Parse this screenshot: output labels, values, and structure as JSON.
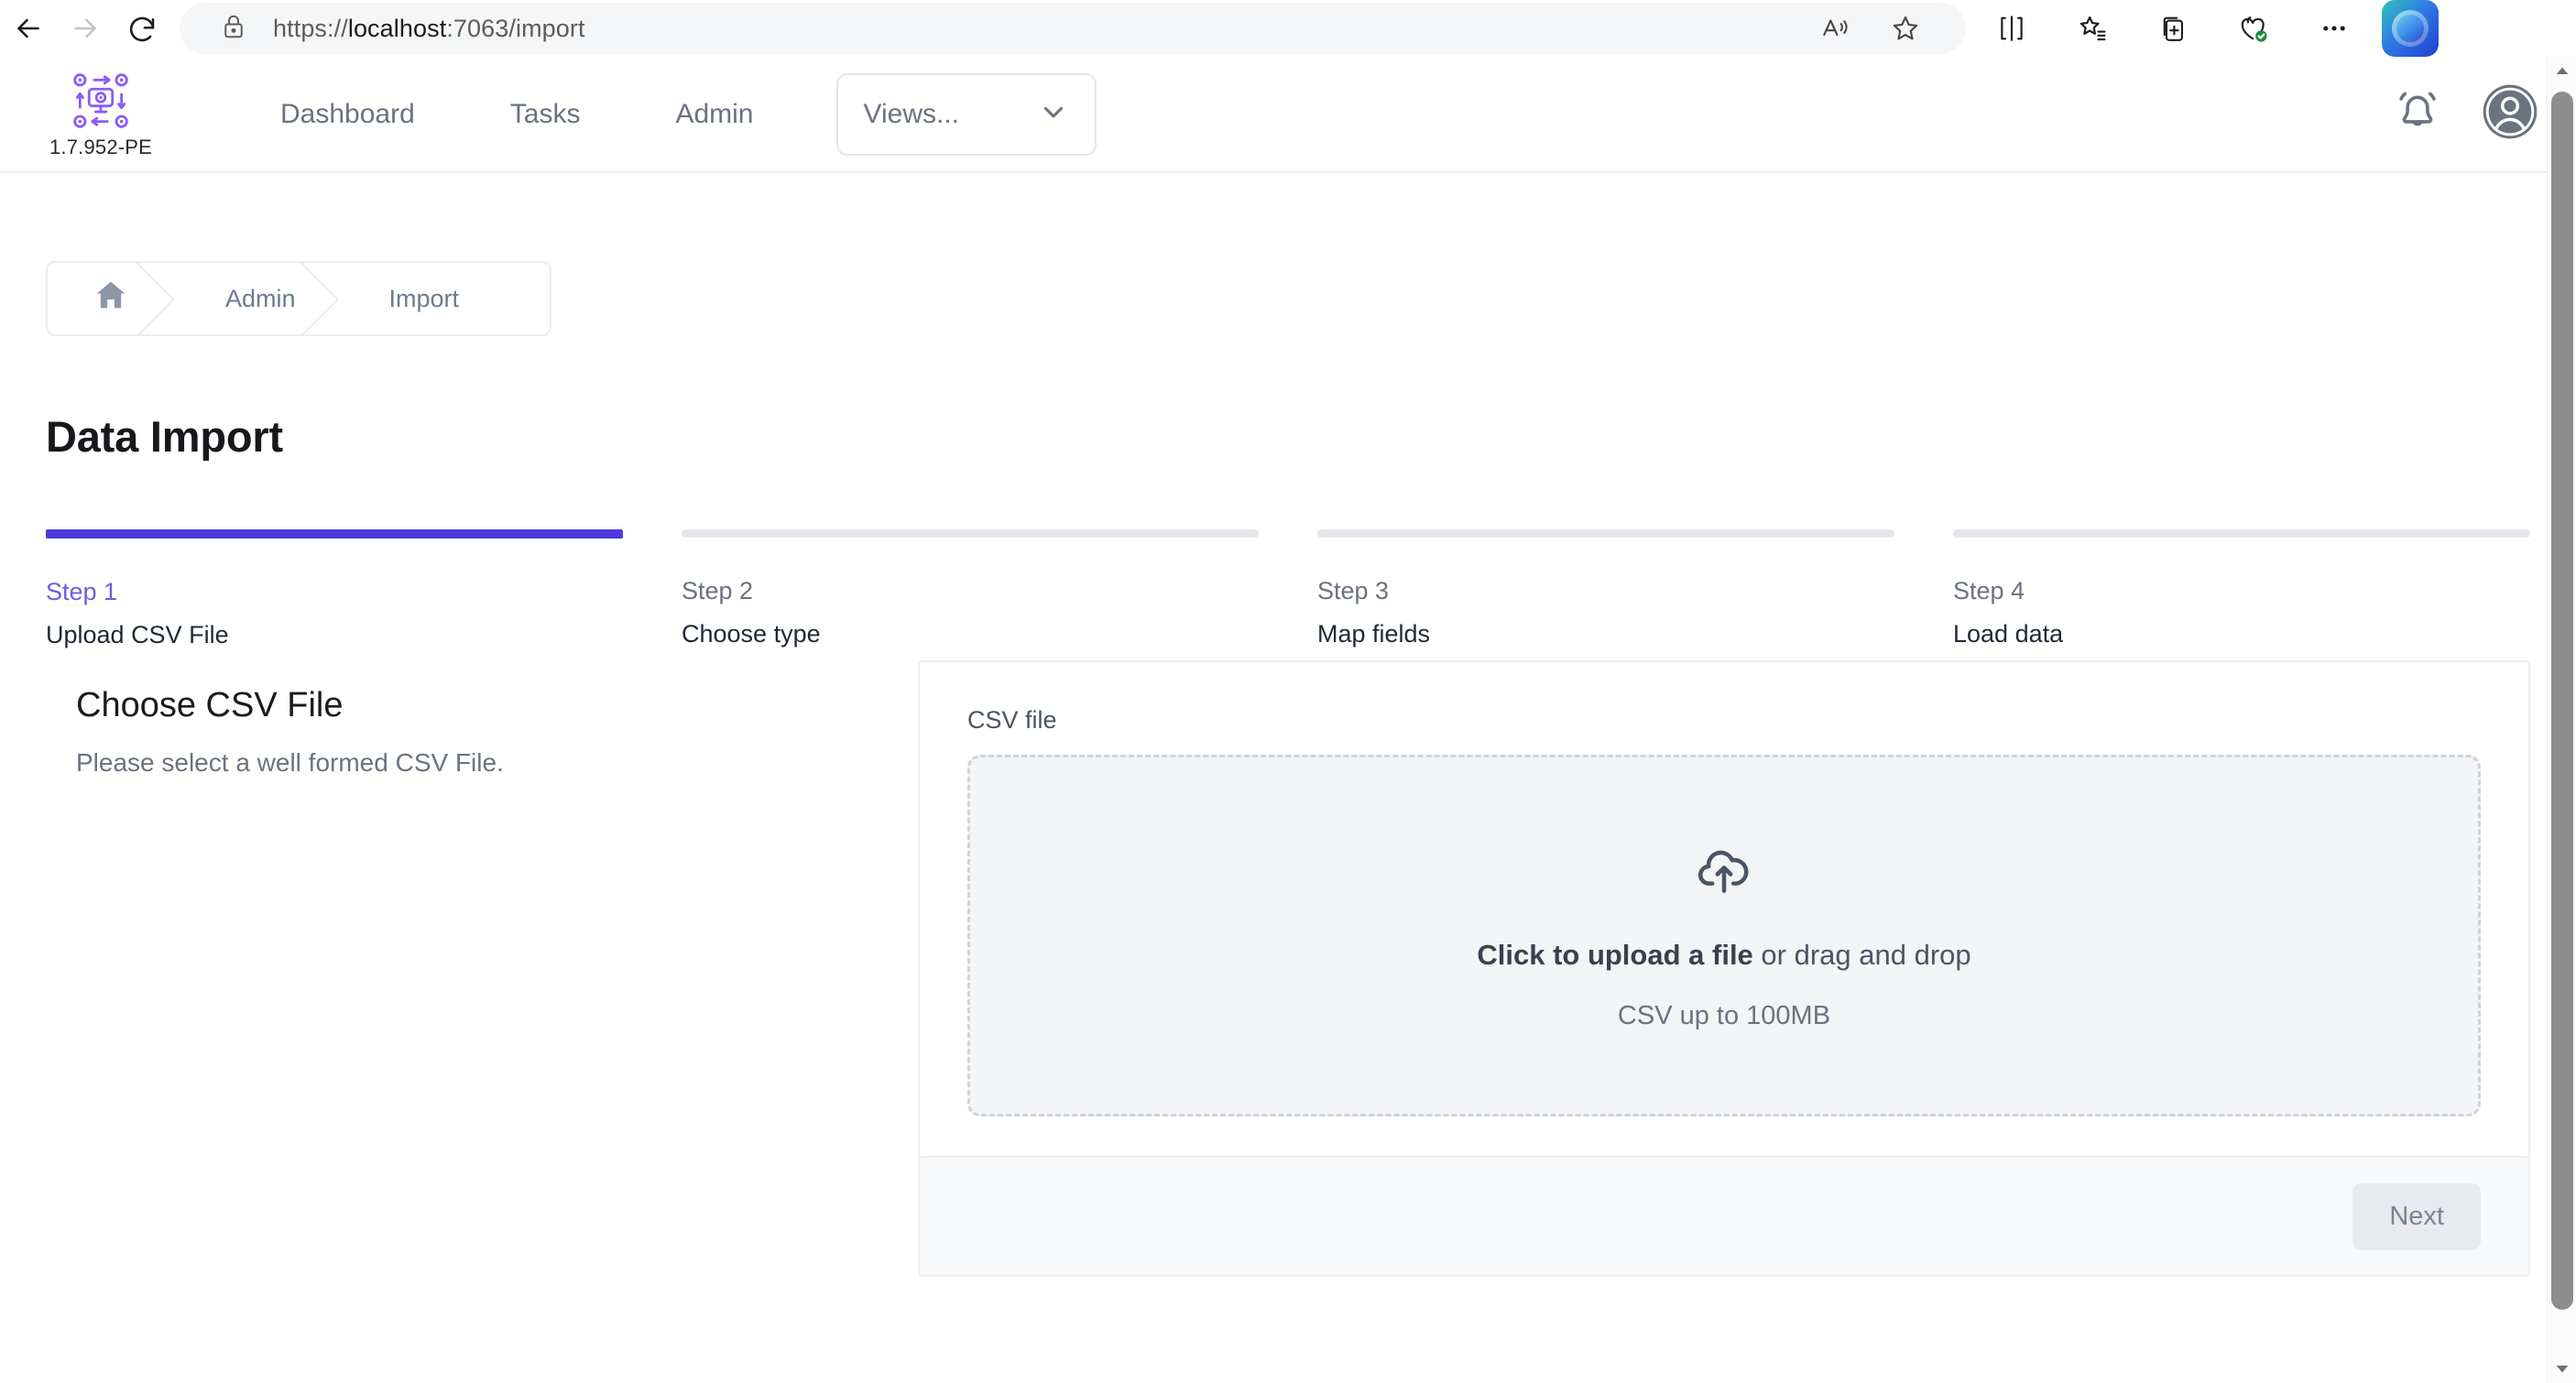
{
  "browser": {
    "back_icon": "arrow-left-icon",
    "forward_icon": "arrow-right-icon",
    "reload_icon": "reload-icon",
    "lock_icon": "lock-icon",
    "url_prefix": "https://",
    "url_host": "localhost",
    "url_suffix": ":7063/import",
    "url_full": "https://localhost:7063/import",
    "toolbar_icons": [
      "read-aloud-icon",
      "favorite-star-icon",
      "split-screen-icon",
      "collections-icon",
      "add-to-collection-icon",
      "browser-essentials-icon",
      "settings-more-icon",
      "copilot-icon"
    ]
  },
  "app_header": {
    "logo_icon": "automation-hub-logo",
    "version": "1.7.952-PE",
    "nav": [
      {
        "label": "Dashboard"
      },
      {
        "label": "Tasks"
      },
      {
        "label": "Admin"
      }
    ],
    "views_select": {
      "value": "Views...",
      "chevron_icon": "chevron-down-icon"
    },
    "notifications_icon": "bell-icon",
    "avatar_icon": "user-avatar-icon"
  },
  "breadcrumb": {
    "home_icon": "home-icon",
    "items": [
      {
        "label": "Admin"
      },
      {
        "label": "Import"
      }
    ]
  },
  "page": {
    "title": "Data Import"
  },
  "stepper": {
    "active_index": 0,
    "active_color": "#4f39d9",
    "inactive_color": "#e5e7eb",
    "steps": [
      {
        "number": "Step 1",
        "name": "Upload CSV File"
      },
      {
        "number": "Step 2",
        "name": "Choose type"
      },
      {
        "number": "Step 3",
        "name": "Map fields"
      },
      {
        "number": "Step 4",
        "name": "Load data"
      }
    ]
  },
  "left_panel": {
    "title": "Choose CSV File",
    "subtitle": "Please select a well formed CSV File."
  },
  "upload_card": {
    "field_label": "CSV file",
    "dropzone": {
      "icon": "cloud-upload-icon",
      "main_bold": "Click to upload a file",
      "main_rest": " or drag and drop",
      "hint": "CSV up to 100MB"
    },
    "footer": {
      "next_label": "Next"
    }
  },
  "scrollbar": {
    "up_icon": "scroll-up-arrow-icon",
    "down_icon": "scroll-down-arrow-icon"
  }
}
